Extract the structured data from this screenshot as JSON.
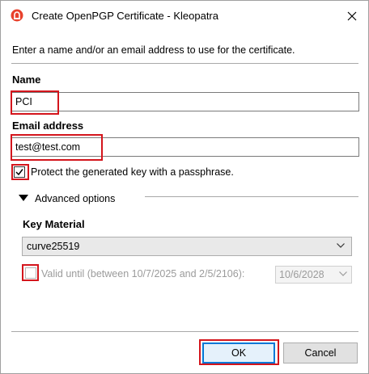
{
  "window": {
    "title": "Create OpenPGP Certificate - Kleopatra",
    "icons": {
      "app": "kleopatra-icon",
      "close": "close-icon"
    }
  },
  "intro_text": "Enter a name and/or an email address to use for the certificate.",
  "name": {
    "label": "Name",
    "value": "PCI"
  },
  "email": {
    "label": "Email address",
    "value": "test@test.com"
  },
  "passphrase": {
    "label": "Protect the generated key with a passphrase.",
    "checked": true
  },
  "advanced": {
    "label": "Advanced options",
    "expanded": true,
    "key_material": {
      "label": "Key Material",
      "selected": "curve25519"
    },
    "valid_until": {
      "label": "Valid until (between 10/7/2025 and 2/5/2106):",
      "checked": false,
      "date": "10/6/2028"
    }
  },
  "buttons": {
    "ok": "OK",
    "cancel": "Cancel"
  },
  "colors": {
    "highlight": "#d4151c",
    "focus": "#0078d7",
    "app_icon": "#e8412c"
  }
}
